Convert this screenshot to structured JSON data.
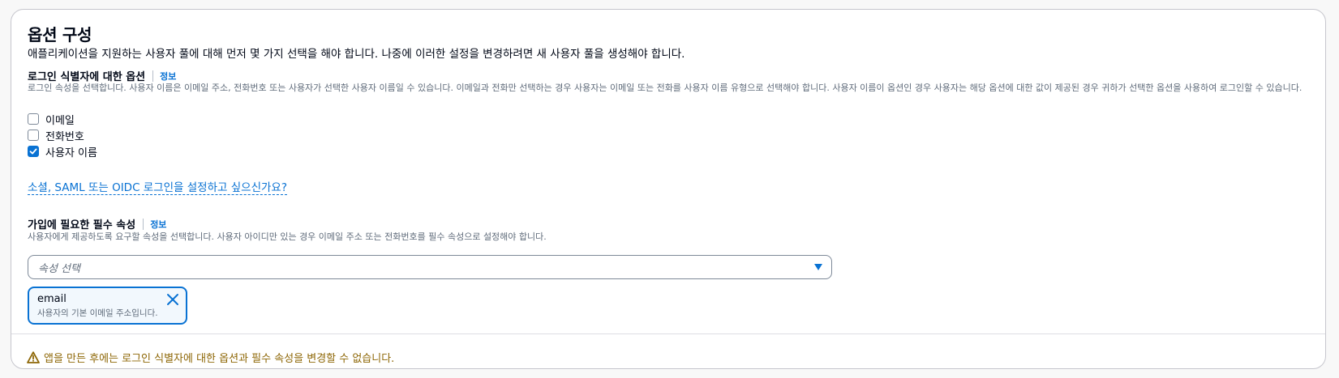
{
  "header": {
    "title": "옵션 구성",
    "description": "애플리케이션을 지원하는 사용자 풀에 대해 먼저 몇 가지 선택을 해야 합니다. 나중에 이러한 설정을 변경하려면 새 사용자 풀을 생성해야 합니다."
  },
  "sign_in_options": {
    "label": "로그인 식별자에 대한 옵션",
    "info_link": "정보",
    "description": "로그인 속성을 선택합니다. 사용자 이름은 이메일 주소, 전화번호 또는 사용자가 선택한 사용자 이름일 수 있습니다. 이메일과 전화만 선택하는 경우 사용자는 이메일 또는 전화를 사용자 이름 유형으로 선택해야 합니다. 사용자 이름이 옵션인 경우 사용자는 해당 옵션에 대한 값이 제공된 경우 귀하가 선택한 옵션을 사용하여 로그인할 수 있습니다.",
    "checkboxes": [
      {
        "label": "이메일",
        "checked": false
      },
      {
        "label": "전화번호",
        "checked": false
      },
      {
        "label": "사용자 이름",
        "checked": true
      }
    ]
  },
  "federation_link": "소셜, SAML 또는 OIDC 로그인을 설정하고 싶으신가요?",
  "required_attributes": {
    "label": "가입에 필요한 필수 속성",
    "info_link": "정보",
    "description": "사용자에게 제공하도록 요구할 속성을 선택합니다. 사용자 아이디만 있는 경우 이메일 주소 또는 전화번호를 필수 속성으로 설정해야 합니다.",
    "select_placeholder": "속성 선택",
    "tokens": [
      {
        "title": "email",
        "description": "사용자의 기본 이메일 주소입니다."
      }
    ]
  },
  "warning": {
    "icon": "warning-icon",
    "text": "앱을 만든 후에는 로그인 식별자에 대한 옵션과 필수 속성을 변경할 수 없습니다."
  },
  "colors": {
    "accent": "#0972d3",
    "warning": "#8d6605",
    "text_secondary": "#5f6b7a"
  }
}
